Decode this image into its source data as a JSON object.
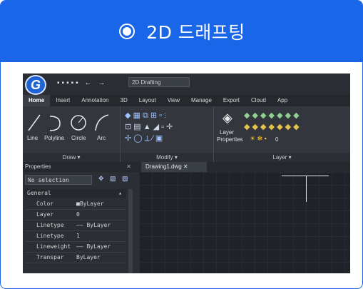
{
  "card": {
    "title": "2D 드래프팅"
  },
  "app": {
    "logo": "G",
    "quick_access_icons": "▪▪▪▪▪ ← →",
    "workspace": "2D Drafting",
    "tabs": [
      "Home",
      "Insert",
      "Annotation",
      "3D",
      "Layout",
      "View",
      "Manage",
      "Export",
      "Cloud",
      "App"
    ],
    "active_tab": "Home",
    "ribbon": {
      "draw": {
        "label": "Draw ▾",
        "tools": [
          "Line",
          "Polyline",
          "Circle",
          "Arc"
        ]
      },
      "modify": {
        "label": "Modify ▾"
      },
      "layer": {
        "label": "Layer ▾",
        "properties_label_1": "Layer",
        "properties_label_2": "Properties",
        "current_layer": "0"
      }
    },
    "properties": {
      "title": "Properties",
      "close_glyph": "✕",
      "selection": "No selection",
      "section": "General",
      "rows": [
        {
          "key": "Color",
          "value": "■ByLayer"
        },
        {
          "key": "Layer",
          "value": "0"
        },
        {
          "key": "Linetype",
          "value": "—— ByLayer"
        },
        {
          "key": "Linetype",
          "value": "1"
        },
        {
          "key": "Lineweight",
          "value": "—— ByLayer"
        },
        {
          "key": "Transpar",
          "value": "ByLayer"
        }
      ]
    },
    "document_tab": "Drawing1.dwg  ✕"
  },
  "colors": {
    "accent": "#1a66e8",
    "app_bg": "#2c2f36",
    "canvas_bg": "#1f2228"
  }
}
